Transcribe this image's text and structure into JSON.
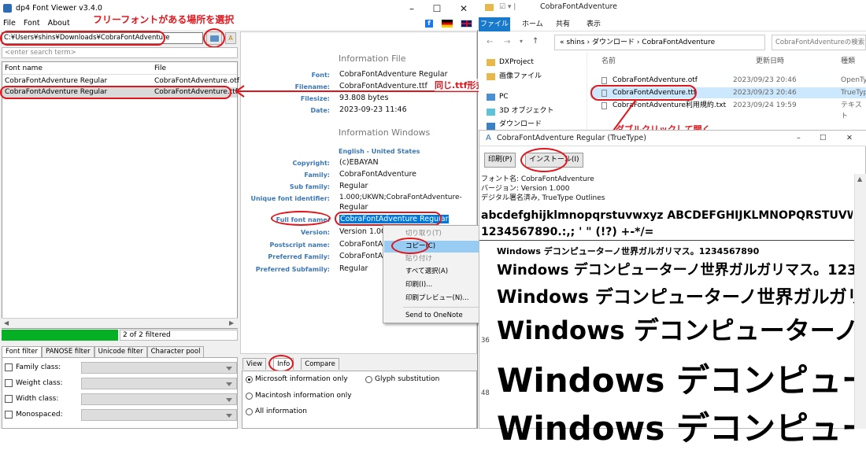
{
  "app": {
    "title": "dp4 Font Viewer v3.4.0",
    "menu": [
      "File",
      "Font",
      "About"
    ]
  },
  "annotations": {
    "select_folder": "フリーフォントがある場所を選択",
    "select_ttf": "同じ.ttf形式のほうを選んでるか",
    "double_click": "ダブルクリックして開く"
  },
  "path": {
    "value": "C:¥Users¥shins¥Downloads¥CobraFontAdventure"
  },
  "search": {
    "placeholder": "<enter search term>"
  },
  "list": {
    "headers": [
      "Font name",
      "File"
    ],
    "rows": [
      {
        "name": "CobraFontAdventure Regular",
        "file": "CobraFontAdventure.otf"
      },
      {
        "name": "CobraFontAdventure Regular",
        "file": "CobraFontAdventure.ttf"
      }
    ]
  },
  "status": {
    "filtered": "2 of 2 filtered"
  },
  "filter_tabs": [
    "Font filter",
    "PANOSE filter",
    "Unicode filter",
    "Character pool"
  ],
  "filters": [
    "Family class:",
    "Weight class:",
    "Width class:",
    "Monospaced:"
  ],
  "info": {
    "file_header": "Information File",
    "windows_header": "Information Windows",
    "lang": "English - United States",
    "file_fields": [
      {
        "label": "Font:",
        "value": "CobraFontAdventure Regular"
      },
      {
        "label": "Filename:",
        "value": "CobraFontAdventure.ttf"
      },
      {
        "label": "Filesize:",
        "value": "93.808 bytes"
      },
      {
        "label": "Date:",
        "value": "2023-09-23 11:46"
      }
    ],
    "win_fields": [
      {
        "label": "Copyright:",
        "value": "(c)EBAYAN"
      },
      {
        "label": "Family:",
        "value": "CobraFontAdventure"
      },
      {
        "label": "Sub family:",
        "value": "Regular"
      },
      {
        "label": "Unique font identifier:",
        "value": "1.000;UKWN;CobraFontAdventure-"
      },
      {
        "label": "",
        "value": "Regular"
      },
      {
        "label": "Full font name:",
        "value": "CobraFontAdventure Regular"
      },
      {
        "label": "Version:",
        "value": "Version 1.000"
      },
      {
        "label": "Postscript name:",
        "value": "CobraFontAdv"
      },
      {
        "label": "Preferred Family:",
        "value": "CobraFontAdv"
      },
      {
        "label": "Preferred Subfamily:",
        "value": "Regular"
      }
    ]
  },
  "context_menu": [
    "切り取り(T)",
    "コピー(C)",
    "貼り付け",
    "すべて選択(A)",
    "印刷(I)...",
    "印刷プレビュー(N)...",
    "Send to OneNote"
  ],
  "bottom_tabs": [
    "View",
    "Info",
    "Compare"
  ],
  "radios": [
    "Microsoft information only",
    "Glyph substitution",
    "Macintosh information only",
    "All information"
  ],
  "explorer": {
    "title": "CobraFontAdventure",
    "ribbon": [
      "ファイル",
      "ホーム",
      "共有",
      "表示"
    ],
    "breadcrumb": "« shins › ダウンロード › CobraFontAdventure",
    "search_placeholder": "CobraFontAdventureの検索",
    "nav": [
      "DXProject",
      "画像ファイル",
      "PC",
      "3D オブジェクト",
      "ダウンロード"
    ],
    "headers": [
      "名前",
      "更新日時",
      "種類"
    ],
    "files": [
      {
        "name": "CobraFontAdventure.otf",
        "date": "2023/09/23 20:46",
        "type": "OpenTy"
      },
      {
        "name": "CobraFontAdventure.ttf",
        "date": "2023/09/23 20:46",
        "type": "TrueTyp"
      },
      {
        "name": "CobraFontAdventure利用規約.txt",
        "date": "2023/09/24 19:59",
        "type": "テキスト"
      }
    ]
  },
  "preview": {
    "title": "CobraFontAdventure Regular (TrueType)",
    "print_label": "印刷(P)",
    "install_label": "インストール(I)",
    "meta": [
      "フォント名: CobraFontAdventure",
      "バージョン: Version 1.000",
      "デジタル署名済み, TrueType Outlines"
    ],
    "alphabet": "abcdefghijklmnopqrstuvwxyz ABCDEFGHIJKLMNOPQRSTUVWXYZ",
    "digits": "1234567890.:,; ' \" (!?) +-*/=",
    "sample": "Windows デコンピューターノ世界ガルガリマス。1234567890",
    "sizes": [
      "36",
      "48"
    ]
  },
  "colors": {
    "accent": "#1979ca",
    "annotation": "#e1161c",
    "progress": "#06b025",
    "label": "#3b78b5"
  }
}
